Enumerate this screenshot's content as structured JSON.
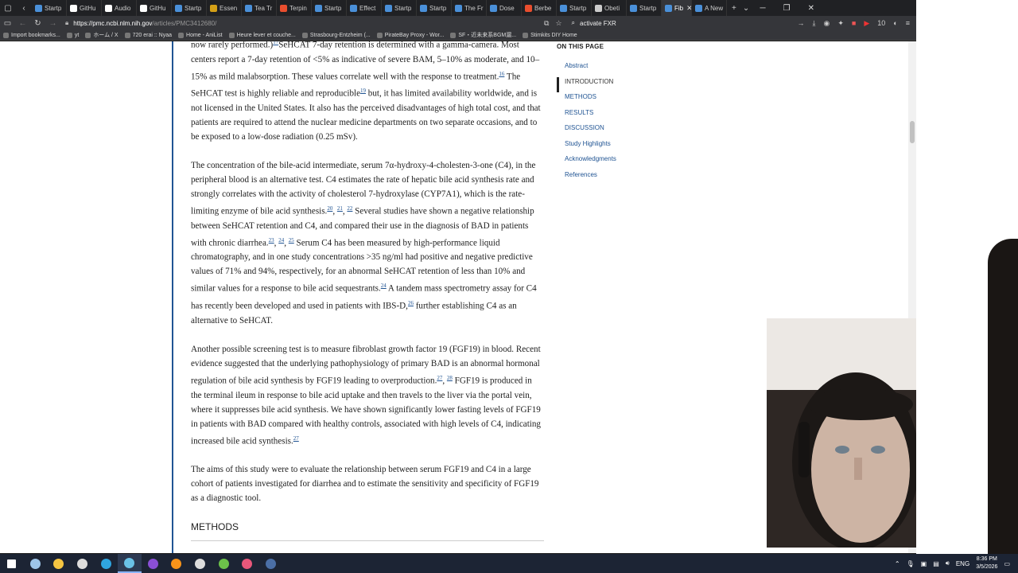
{
  "browser": {
    "tabs": [
      {
        "label": "Startp",
        "color": "#4a90d9"
      },
      {
        "label": "GitHu",
        "color": "#ffffff"
      },
      {
        "label": "Audio",
        "color": "#ffffff"
      },
      {
        "label": "GitHu",
        "color": "#ffffff"
      },
      {
        "label": "Startp",
        "color": "#4a90d9"
      },
      {
        "label": "Essen",
        "color": "#d4a017"
      },
      {
        "label": "Tea Tr",
        "color": "#4a90d9"
      },
      {
        "label": "Terpin",
        "color": "#e94e2e"
      },
      {
        "label": "Startp",
        "color": "#4a90d9"
      },
      {
        "label": "Effect",
        "color": "#4a90d9"
      },
      {
        "label": "Startp",
        "color": "#4a90d9"
      },
      {
        "label": "Startp",
        "color": "#4a90d9"
      },
      {
        "label": "The Fr",
        "color": "#4a90d9"
      },
      {
        "label": "Dose",
        "color": "#4a90d9"
      },
      {
        "label": "Berbe",
        "color": "#e94e2e"
      },
      {
        "label": "Startp",
        "color": "#4a90d9"
      },
      {
        "label": "Obeti",
        "color": "#cccccc"
      },
      {
        "label": "Startp",
        "color": "#4a90d9"
      },
      {
        "label": "Fib",
        "color": "#4a90d9",
        "active": true
      },
      {
        "label": "A New",
        "color": "#4a90d9"
      }
    ],
    "url_host": "https://pmc.ncbi.nlm.nih.gov",
    "url_path": "/articles/PMC3412680/",
    "search_text": "activate FXR",
    "bookmarks": [
      "Import bookmarks...",
      "yt",
      "ホーム / X",
      "720 erai :: Nyaa",
      "Home - AniList",
      "Heure lever et couche...",
      "Strasbourg-Entzheim (...",
      "PirateBay Proxy - Wor...",
      "SF・近未来系BGM漏...",
      "Stimkits DIY Home"
    ]
  },
  "article": {
    "paragraphs": [
      [
        {
          "t": "now rarely performed.)"
        },
        {
          "sup": "17"
        },
        {
          "t": "SeHCAT 7-day retention is determined with a gamma-camera. Most centers report a 7-day retention of <5% as indicative of severe BAM, 5–10% as moderate, and 10–15% as mild malabsorption. These values correlate well with the response to treatment."
        },
        {
          "sup": "16"
        },
        {
          "t": " The SeHCAT test is highly reliable and reproducible"
        },
        {
          "sup": "19"
        },
        {
          "t": " but, it has limited availability worldwide, and is not licensed in the United States. It also has the perceived disadvantages of high total cost, and that patients are required to attend the nuclear medicine departments on two separate occasions, and to be exposed to a low-dose radiation (0.25 mSv)."
        }
      ],
      [
        {
          "t": "The concentration of the bile-acid intermediate, serum 7α-hydroxy-4-cholesten-3-one (C4), in the peripheral blood is an alternative test. C4 estimates the rate of hepatic bile acid synthesis rate and strongly correlates with the activity of cholesterol 7-hydroxylase (CYP7A1), which is the rate-limiting enzyme of bile acid synthesis."
        },
        {
          "sup": "20"
        },
        {
          "t": ", "
        },
        {
          "sup": "21"
        },
        {
          "t": ", "
        },
        {
          "sup": "22"
        },
        {
          "t": " Several studies have shown a negative relationship between SeHCAT retention and C4, and compared their use in the diagnosis of BAD in patients with chronic diarrhea."
        },
        {
          "sup": "23"
        },
        {
          "t": ", "
        },
        {
          "sup": "24"
        },
        {
          "t": ", "
        },
        {
          "sup": "25"
        },
        {
          "t": " Serum C4 has been measured by high-performance liquid chromatography, and in one study concentrations >35 ng/ml had positive and negative predictive values of 71% and 94%, respectively, for an abnormal SeHCAT retention of less than 10% and similar values for a response to bile acid sequestrants."
        },
        {
          "sup": "24"
        },
        {
          "t": " A tandem mass spectrometry assay for C4 has recently been developed and used in patients with IBS-D,"
        },
        {
          "sup": "26"
        },
        {
          "t": " further establishing C4 as an alternative to SeHCAT."
        }
      ],
      [
        {
          "t": "Another possible screening test is to measure fibroblast growth factor 19 (FGF19) in blood. Recent evidence suggested that the underlying pathophysiology of primary BAD is an abnormal hormonal regulation of bile acid synthesis by FGF19 leading to overproduction."
        },
        {
          "sup": "27"
        },
        {
          "t": ", "
        },
        {
          "sup": "28"
        },
        {
          "t": " FGF19 is produced in the terminal ileum in response to bile acid uptake and then travels to the liver via the portal vein, where it suppresses bile acid synthesis. We have shown significantly lower fasting levels of FGF19 in patients with BAD compared with healthy controls, associated with high levels of C4, indicating increased bile acid synthesis."
        },
        {
          "sup": "27"
        }
      ],
      [
        {
          "t": "The aims of this study were to evaluate the relationship between serum FGF19 and C4 in a large cohort of patients investigated for diarrhea and to estimate the sensitivity and specificity of FGF19 as a diagnostic tool."
        }
      ]
    ],
    "next_heading": "METHODS"
  },
  "toc": {
    "heading": "ON THIS PAGE",
    "items": [
      "Abstract",
      "INTRODUCTION",
      "METHODS",
      "RESULTS",
      "DISCUSSION",
      "Study Highlights",
      "Acknowledgments",
      "References"
    ],
    "active_index": 1
  },
  "taskbar": {
    "apps": [
      {
        "name": "windows-start",
        "color": "#ffffff"
      },
      {
        "name": "notes",
        "color": "#9ec5e8"
      },
      {
        "name": "file-explorer",
        "color": "#f5c542"
      },
      {
        "name": "wolf-app",
        "color": "#dddddd"
      },
      {
        "name": "edge",
        "color": "#2fa5e0"
      },
      {
        "name": "pinned-app",
        "color": "#6ac2e6",
        "active": true
      },
      {
        "name": "firefox",
        "color": "#8a4fd6"
      },
      {
        "name": "bitcoin",
        "color": "#f7931a"
      },
      {
        "name": "obs",
        "color": "#dddddd"
      },
      {
        "name": "vim",
        "color": "#6cc24a"
      },
      {
        "name": "media-app",
        "color": "#e8577a"
      },
      {
        "name": "steam",
        "color": "#4b6fa6"
      }
    ],
    "language": "ENG",
    "time": "8:36 PM",
    "date": "3/5/2026"
  }
}
